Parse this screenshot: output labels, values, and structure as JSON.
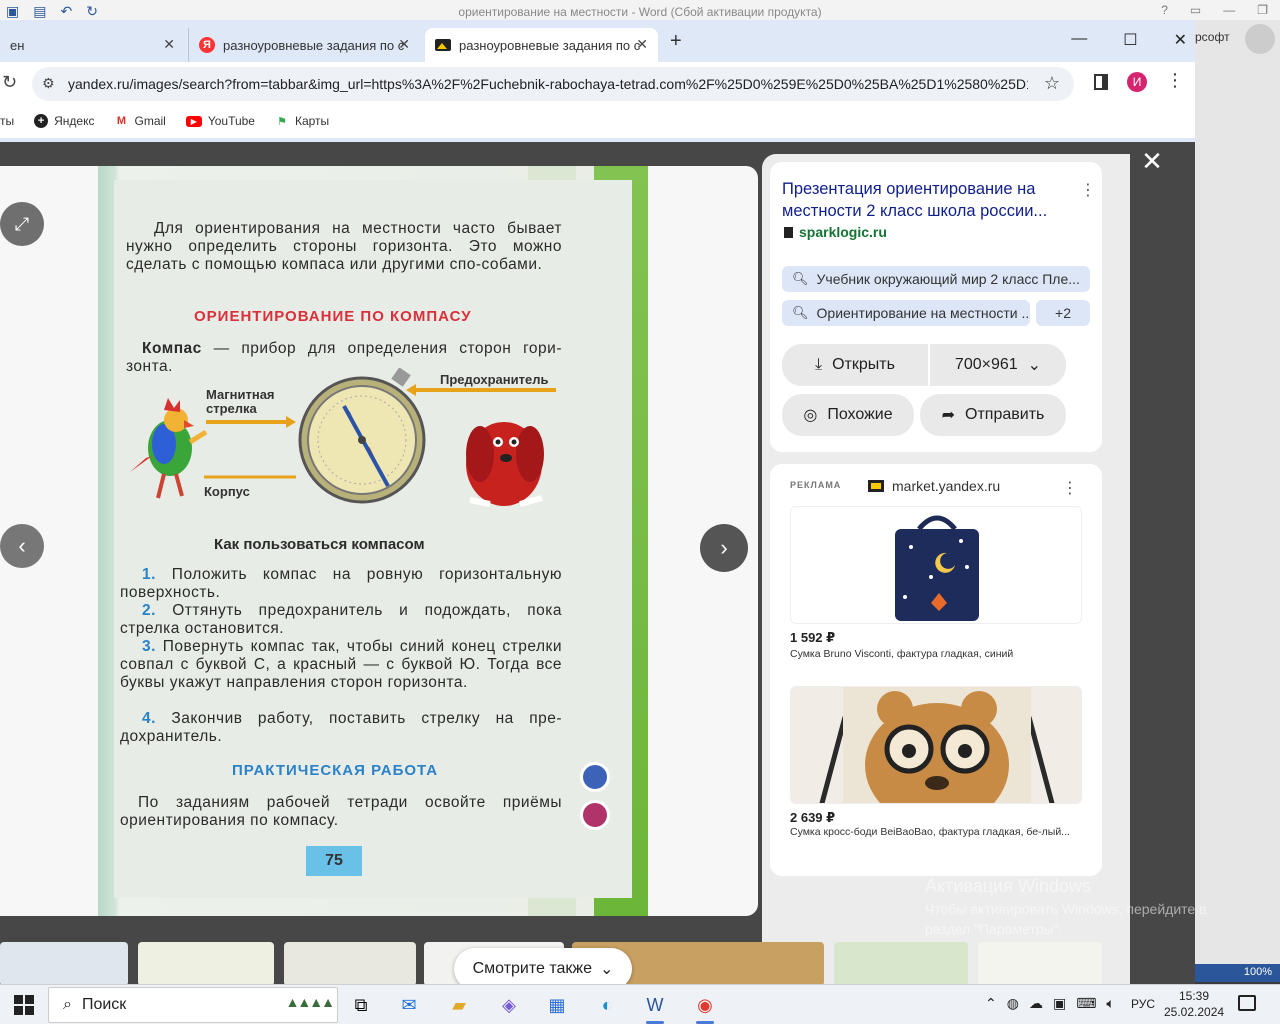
{
  "word": {
    "title": "ориентирование на местности - Word (Сбой активации продукта)",
    "account": "рсофт",
    "zoom": "100%"
  },
  "chrome": {
    "tabs": [
      {
        "label": "ен"
      },
      {
        "label": "разноуровневые задания по с"
      },
      {
        "label": "разноуровневые задания по с"
      }
    ],
    "url": "yandex.ru/images/search?from=tabbar&img_url=https%3A%2F%2Fuchebnik-rabochaya-tetrad.com%2F%25D0%259E%25D0%25BA%25D1%2580%25D1%...",
    "profile_letter": "И",
    "bookmarks": [
      {
        "label": "ты"
      },
      {
        "label": "Яндекс"
      },
      {
        "label": "Gmail"
      },
      {
        "label": "YouTube"
      },
      {
        "label": "Карты"
      }
    ]
  },
  "book": {
    "intro": "Для ориентирования на местности часто бывает нужно определить стороны горизонта. Это можно сделать с помощью компаса или другими спо-собами.",
    "heading": "ОРИЕНТИРОВАНИЕ ПО КОМПАСУ",
    "compass_term": "Компас",
    "compass_def": " — прибор для определения сторон гори-зонта.",
    "label_needle": "Магнитная стрелка",
    "label_guard": "Предохранитель",
    "label_body": "Корпус",
    "how_heading": "Как пользоваться компасом",
    "steps": [
      {
        "num": "1.",
        "text": "Положить компас на ровную горизонтальную поверхность."
      },
      {
        "num": "2.",
        "text": "Оттянуть предохранитель и подождать, пока стрелка остановится."
      },
      {
        "num": "3.",
        "text": "Повернуть компас так, чтобы синий конец стрелки совпал с буквой С, а красный — с буквой Ю. Тогда все буквы укажут направления сторон горизонта."
      },
      {
        "num": "4.",
        "text": "Закончив работу, поставить стрелку на пре-дохранитель."
      }
    ],
    "practice_heading": "ПРАКТИЧЕСКАЯ РАБОТА",
    "practice_text": "По заданиям рабочей тетради освойте приёмы ориентирования по компасу.",
    "page_number": "75"
  },
  "info": {
    "title": "Презентация ориентирование на местности 2 класс школа россии...",
    "source": "sparklogic.ru",
    "chips": [
      "Учебник окружающий мир 2 класс Пле...",
      "Ориентирование на местности ..."
    ],
    "chips_more": "+2",
    "open_label": "Открыть",
    "size_label": "700×961",
    "similar_label": "Похожие",
    "share_label": "Отправить"
  },
  "ad": {
    "label": "РЕКЛАМА",
    "market": "market.yandex.ru",
    "products": [
      {
        "price": "1 592 ₽",
        "desc": "Сумка Bruno Visconti, фактура гладкая, синий"
      },
      {
        "price": "2 639 ₽",
        "desc": "Сумка кросс-боди BeiBaoBao, фактура гладкая, бе-лый..."
      }
    ]
  },
  "activation": {
    "title": "Активация Windows",
    "text": "Чтобы активировать Windows, перейдите в раздел \"Параметры\"."
  },
  "see_also": "Смотрите также",
  "taskbar": {
    "search": "Поиск",
    "lang": "РУС",
    "time": "15:39",
    "date": "25.02.2024"
  },
  "colors": {
    "chrome_tabstrip": "#dfe8f7",
    "link_title": "#0f1f8c",
    "source_green": "#137333",
    "book_heading_red": "#d9303b",
    "book_number_blue": "#2a82c9"
  }
}
